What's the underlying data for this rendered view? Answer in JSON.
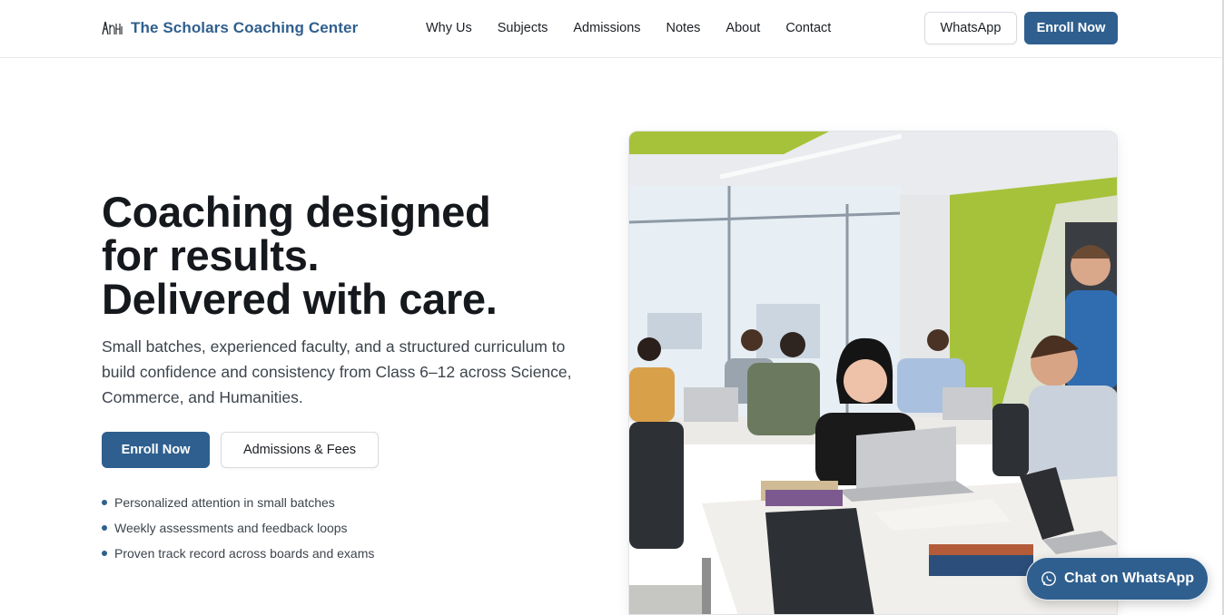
{
  "header": {
    "brand_name": "The Scholars Coaching Center",
    "logo_icon": "scholars-logo-icon",
    "nav": [
      "Why Us",
      "Subjects",
      "Admissions",
      "Notes",
      "About",
      "Contact"
    ],
    "whatsapp_label": "WhatsApp",
    "enroll_label": "Enroll Now"
  },
  "hero": {
    "title_lines": [
      "Coaching designed",
      "for results.",
      "Delivered with care."
    ],
    "subtitle": "Small batches, experienced faculty, and a structured curriculum to build confidence and consistency from Class 6–12 across Science, Commerce, and Humanities.",
    "primary_cta": "Enroll Now",
    "secondary_cta": "Admissions & Fees",
    "bullets": [
      "Personalized attention in small batches",
      "Weekly assessments and feedback loops",
      "Proven track record across boards and exams"
    ],
    "image_subject": "classroom-photo"
  },
  "floating": {
    "chat_label": "Chat on WhatsApp",
    "chat_icon": "whatsapp-icon"
  },
  "colors": {
    "brand": "#2f5f8e",
    "text": "#15181c",
    "muted": "#3d444c",
    "border": "#d7dbe0",
    "wall_green": "#a6c23a"
  }
}
